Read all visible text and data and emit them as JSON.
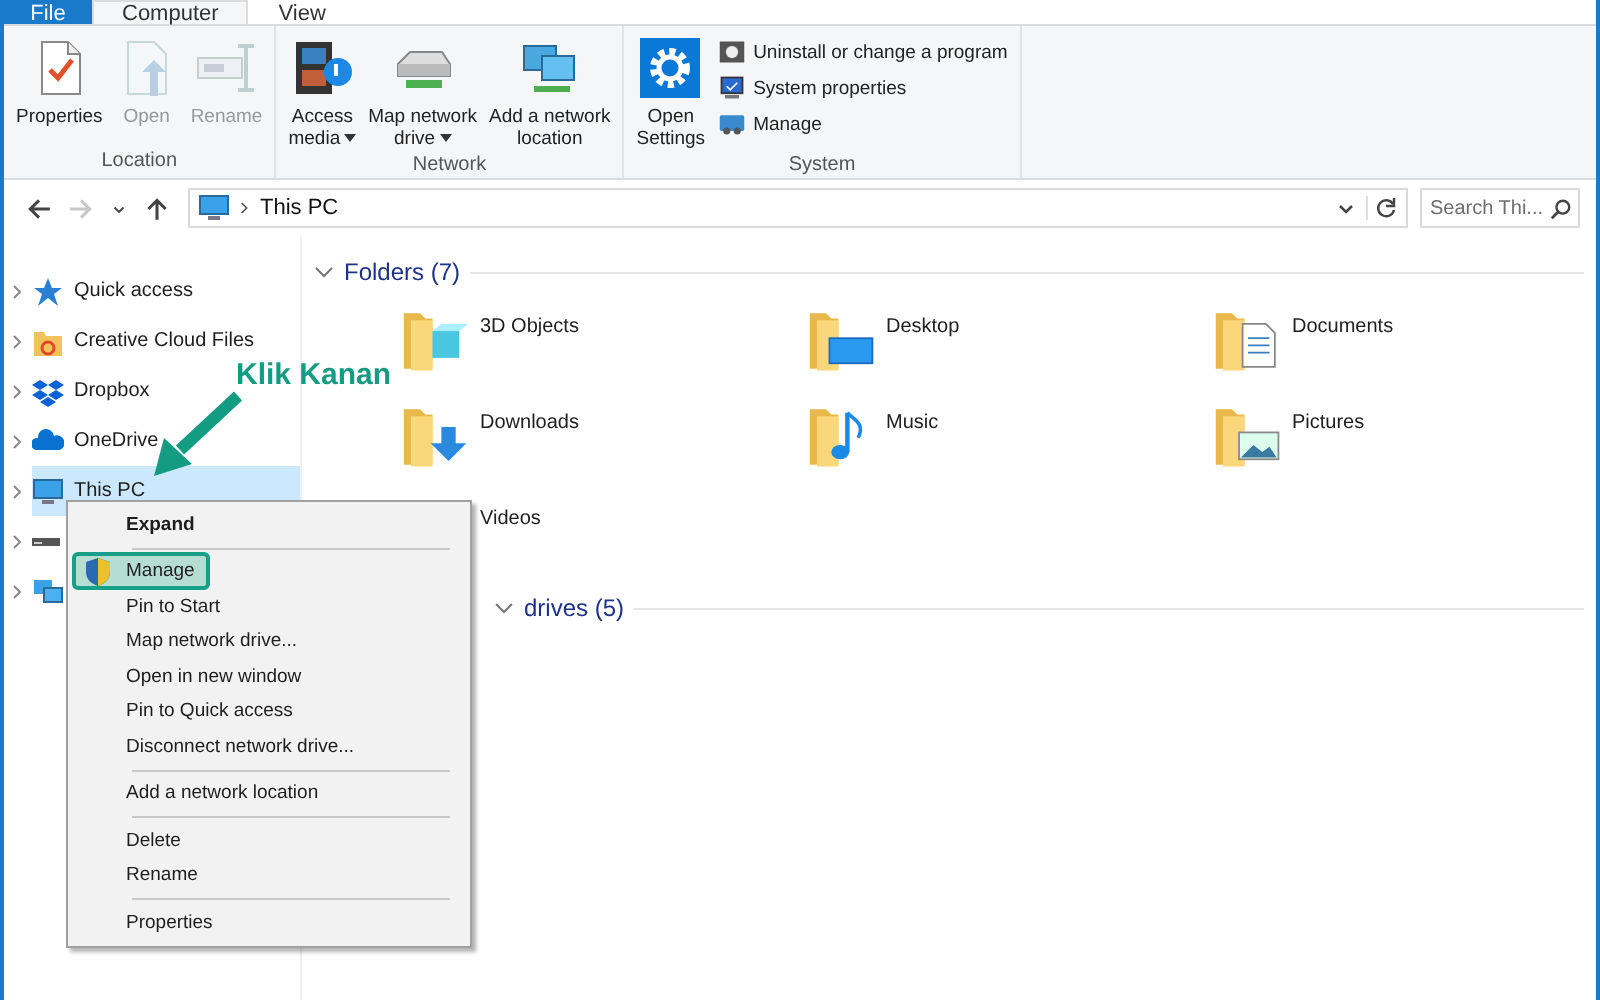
{
  "ribbon": {
    "tabs": [
      {
        "label": "File",
        "kind": "file",
        "selected": false
      },
      {
        "label": "Computer",
        "kind": "tab",
        "selected": true
      },
      {
        "label": "View",
        "kind": "tab",
        "selected": false
      }
    ],
    "groups": [
      {
        "label": "Location",
        "buttons": [
          {
            "kind": "properties",
            "label": "Properties",
            "disabled": false,
            "dropdown": false
          },
          {
            "kind": "open",
            "label": "Open",
            "disabled": true,
            "dropdown": false
          },
          {
            "kind": "rename",
            "label": "Rename",
            "disabled": true,
            "dropdown": false
          }
        ]
      },
      {
        "label": "Network",
        "buttons": [
          {
            "kind": "media",
            "label": "Access\nmedia",
            "disabled": false,
            "dropdown": true
          },
          {
            "kind": "mapdrive",
            "label": "Map network\ndrive",
            "disabled": false,
            "dropdown": true
          },
          {
            "kind": "netloc",
            "label": "Add a network\nlocation",
            "disabled": false,
            "dropdown": false
          }
        ]
      },
      {
        "label": "System",
        "buttons": [
          {
            "kind": "settings",
            "label": "Open\nSettings",
            "disabled": false,
            "dropdown": false
          }
        ],
        "small_buttons": [
          {
            "kind": "uninstall",
            "label": "Uninstall or change a program"
          },
          {
            "kind": "sysprops",
            "label": "System properties"
          },
          {
            "kind": "manage",
            "label": "Manage"
          }
        ]
      }
    ]
  },
  "address_bar": {
    "nav": [
      {
        "kind": "back",
        "disabled": false
      },
      {
        "kind": "forward",
        "disabled": true
      },
      {
        "kind": "recent",
        "disabled": false
      },
      {
        "kind": "up",
        "disabled": false
      }
    ],
    "path": "This PC",
    "search": {
      "placeholder": "Search Thi..."
    }
  },
  "sidebar": {
    "items": [
      {
        "kind": "star",
        "label": "Quick access",
        "selected": false
      },
      {
        "kind": "cloudfiles",
        "label": "Creative Cloud Files",
        "selected": false
      },
      {
        "kind": "dropbox",
        "label": "Dropbox",
        "selected": false
      },
      {
        "kind": "onedrive",
        "label": "OneDrive",
        "selected": false
      },
      {
        "kind": "pc",
        "label": "This PC",
        "selected": true
      },
      {
        "kind": "drive",
        "selected": false
      },
      {
        "kind": "network",
        "selected": false
      }
    ]
  },
  "content": {
    "sections": [
      {
        "title": "Folders (7)",
        "items": [
          {
            "kind": "cube",
            "label": "3D Objects"
          },
          {
            "kind": "desktop",
            "label": "Desktop"
          },
          {
            "kind": "documents",
            "label": "Documents"
          },
          {
            "kind": "downloads",
            "label": "Downloads"
          },
          {
            "kind": "music",
            "label": "Music"
          },
          {
            "kind": "pictures",
            "label": "Pictures"
          },
          {
            "label": "Videos"
          }
        ]
      },
      {
        "title": "drives (5)"
      }
    ]
  },
  "context_menu": {
    "items": [
      {
        "kind": "item",
        "label": "Expand",
        "default": true,
        "selected": false
      },
      {
        "kind": "separator"
      },
      {
        "kind": "admin",
        "label": "Manage",
        "default": false,
        "selected": true
      },
      {
        "kind": "item",
        "label": "Pin to Start",
        "default": false,
        "selected": false
      },
      {
        "kind": "item",
        "label": "Map network drive...",
        "default": false,
        "selected": false
      },
      {
        "kind": "item",
        "label": "Open in new window",
        "default": false,
        "selected": false
      },
      {
        "kind": "item",
        "label": "Pin to Quick access",
        "default": false,
        "selected": false
      },
      {
        "kind": "item",
        "label": "Disconnect network drive...",
        "default": false,
        "selected": false
      },
      {
        "kind": "separator"
      },
      {
        "kind": "item",
        "label": "Add a network location",
        "default": false,
        "selected": false
      },
      {
        "kind": "separator"
      },
      {
        "kind": "item",
        "label": "Delete",
        "default": false,
        "selected": false
      },
      {
        "kind": "item",
        "label": "Rename",
        "default": false,
        "selected": false
      },
      {
        "kind": "separator"
      },
      {
        "kind": "item",
        "label": "Properties",
        "default": false,
        "selected": false
      }
    ]
  },
  "annotation": {
    "label": "Klik Kanan"
  }
}
